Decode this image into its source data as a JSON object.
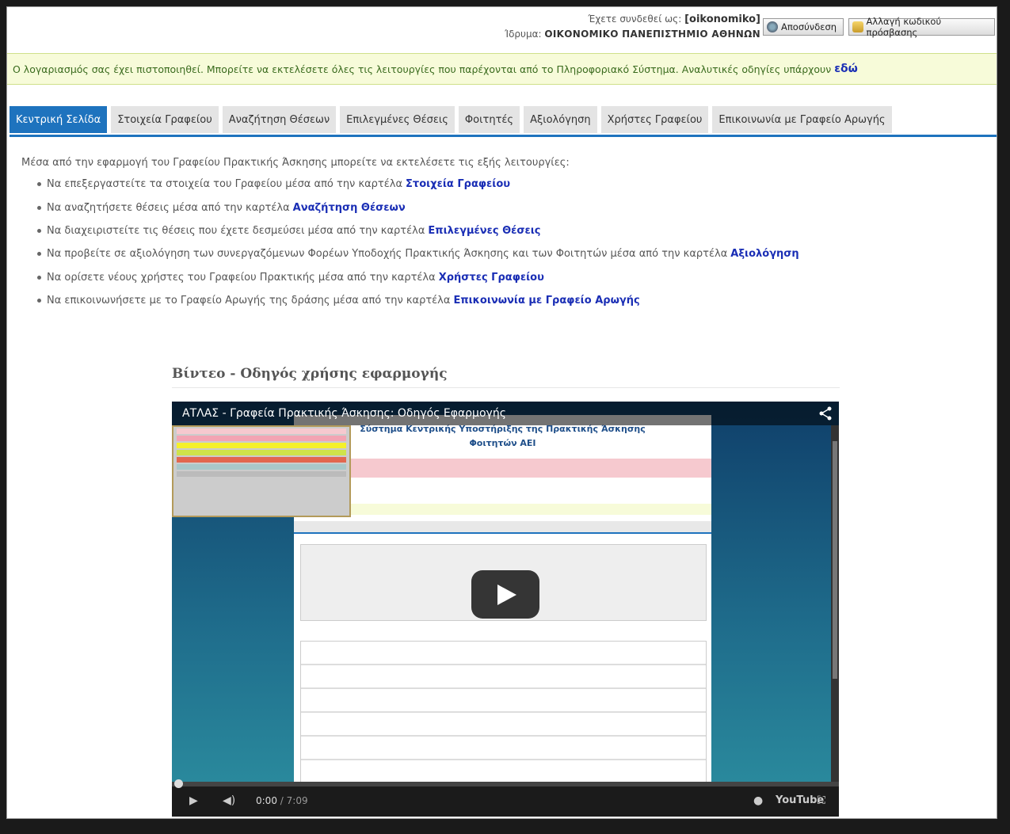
{
  "header": {
    "logged_in_label": "Έχετε συνδεθεί ως:",
    "username": "[oikonomiko]",
    "institution_label": "Ίδρυμα:",
    "institution": "ΟΙΚΟΝΟΜΙΚΟ ΠΑΝΕΠΙΣΤΗΜΙΟ ΑΘΗΝΩΝ",
    "logout_label": "Αποσύνδεση",
    "change_password_label": "Αλλαγή κωδικού πρόσβασης"
  },
  "notice": {
    "text": "Ο λογαριασμός σας έχει πιστοποιηθεί. Μπορείτε να εκτελέσετε όλες τις λειτουργίες που παρέχονται από το Πληροφοριακό Σύστημα. Αναλυτικές οδηγίες υπάρχουν",
    "link": "εδώ"
  },
  "tabs": [
    {
      "label": "Κεντρική Σελίδα",
      "active": true
    },
    {
      "label": "Στοιχεία Γραφείου"
    },
    {
      "label": "Αναζήτηση Θέσεων"
    },
    {
      "label": "Επιλεγμένες Θέσεις"
    },
    {
      "label": "Φοιτητές"
    },
    {
      "label": "Αξιολόγηση"
    },
    {
      "label": "Χρήστες Γραφείου"
    },
    {
      "label": "Επικοινωνία με Γραφείο Αρωγής"
    }
  ],
  "content": {
    "intro": "Μέσα από την εφαρμογή του Γραφείου Πρακτικής Άσκησης μπορείτε να εκτελέσετε τις εξής λειτουργίες:",
    "items": [
      {
        "text": "Να επεξεργαστείτε τα στοιχεία του Γραφείου μέσα από την καρτέλα",
        "link": "Στοιχεία Γραφείου"
      },
      {
        "text": "Να αναζητήσετε θέσεις μέσα από την καρτέλα",
        "link": "Αναζήτηση Θέσεων"
      },
      {
        "text": "Να διαχειριστείτε τις θέσεις που έχετε δεσμεύσει μέσα από την καρτέλα",
        "link": "Επιλεγμένες Θέσεις"
      },
      {
        "text": "Να προβείτε σε αξιολόγηση των συνεργαζόμενων Φορέων Υποδοχής Πρακτικής Άσκησης και των Φοιτητών μέσα από την καρτέλα",
        "link": "Αξιολόγηση"
      },
      {
        "text": "Να ορίσετε νέους χρήστες του Γραφείου Πρακτικής μέσα από την καρτέλα",
        "link": "Χρήστες Γραφείου"
      },
      {
        "text": "Να επικοινωνήσετε με το Γραφείο Αρωγής της δράσης μέσα από την καρτέλα",
        "link": "Επικοινωνία με Γραφείο Αρωγής"
      }
    ]
  },
  "video": {
    "section_title": "Βίντεο - Οδηγός χρήσης εφαρμογής",
    "title": "ΑΤΛΑΣ - Γραφεία Πρακτικής Άσκησης: Οδηγός Εφαρμογής",
    "current_time": "0:00",
    "duration": "/ 7:09",
    "progress": 0,
    "youtube_label": "YouTube",
    "inner_title_1": "Σύστημα Κεντρικής Υποστήριξης της Πρακτικής Άσκησης",
    "inner_title_2": "Φοιτητών ΑΕΙ"
  },
  "colors": {
    "accent": "#1e73be",
    "link": "#1a2eb5",
    "notice_bg": "#f7fbd9",
    "notice_text": "#3a6b1e"
  }
}
